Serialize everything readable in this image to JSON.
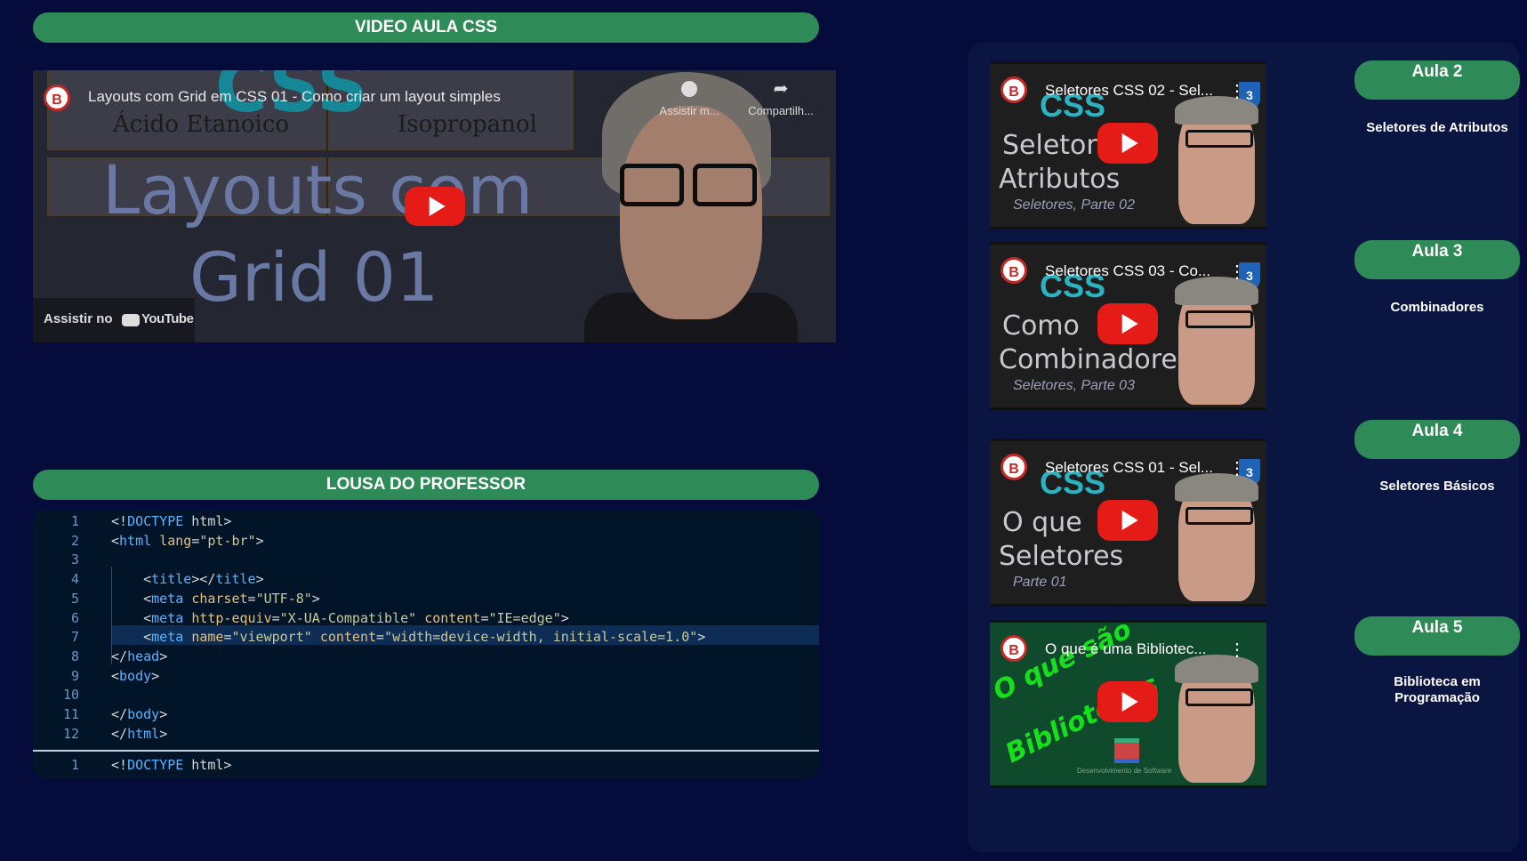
{
  "video_section": {
    "header": "VIDEO AULA CSS",
    "video": {
      "title": "Layouts com Grid em CSS 01 - Como criar um layout simples",
      "bg_line1": "Layouts com",
      "bg_line2": "Grid 01",
      "bg_css": "CSS",
      "cell1": "Ácido Etanoico",
      "cell2": "Isopropanol",
      "watch_later": "Assistir m...",
      "share": "Compartilh...",
      "watch_on": "Assistir no",
      "youtube": "YouTube",
      "channel_icon": "B"
    }
  },
  "board_section": {
    "header": "LOUSA DO PROFESSOR",
    "lines": [
      {
        "n": "1",
        "t": "<!DOCTYPE html>"
      },
      {
        "n": "2",
        "t": "<html lang=\"pt-br\">"
      },
      {
        "n": "3",
        "t": ""
      },
      {
        "n": "4",
        "t": "    <title></title>"
      },
      {
        "n": "5",
        "t": "    <meta charset=\"UTF-8\">"
      },
      {
        "n": "6",
        "t": "    <meta http-equiv=\"X-UA-Compatible\" content=\"IE=edge\">"
      },
      {
        "n": "7",
        "t": "    <meta name=\"viewport\" content=\"width=device-width, initial-scale=1.0\">"
      },
      {
        "n": "8",
        "t": "</head>"
      },
      {
        "n": "9",
        "t": "<body>"
      },
      {
        "n": "10",
        "t": ""
      },
      {
        "n": "11",
        "t": "</body>"
      },
      {
        "n": "12",
        "t": "</html>"
      }
    ],
    "second_pane_line": {
      "n": "1",
      "t": "<!DOCTYPE html>"
    }
  },
  "playlist": [
    {
      "title": "Seletores CSS 02 - Sel...",
      "big1": "Seletores",
      "big2": "Atributos",
      "small": "Seletores, Parte 02",
      "aula": "Aula 2",
      "desc": "Seletores de Atributos"
    },
    {
      "title": "Seletores CSS 03 - Co...",
      "big1": "Como",
      "big2": "Combinadores",
      "small": "Seletores, Parte 03",
      "aula": "Aula 3",
      "desc": "Combinadores"
    },
    {
      "title": "Seletores CSS 01 - Sel...",
      "big1": "O que",
      "big2": "Seletores",
      "small": "Parte 01",
      "aula": "Aula 4",
      "desc": "Seletores Básicos"
    },
    {
      "title": "O que é uma Bibliotec...",
      "big1": "O que são",
      "big2": "Bibliotecas",
      "small": "Desenvolvimento de Software",
      "aula": "Aula 5",
      "desc": "Biblioteca em Programação"
    }
  ],
  "thumb_css_word": "CSS",
  "colors": {
    "background": "#050b3b",
    "accent": "#2e8b57",
    "panel": "#0a1541",
    "code_bg": "#021428"
  }
}
